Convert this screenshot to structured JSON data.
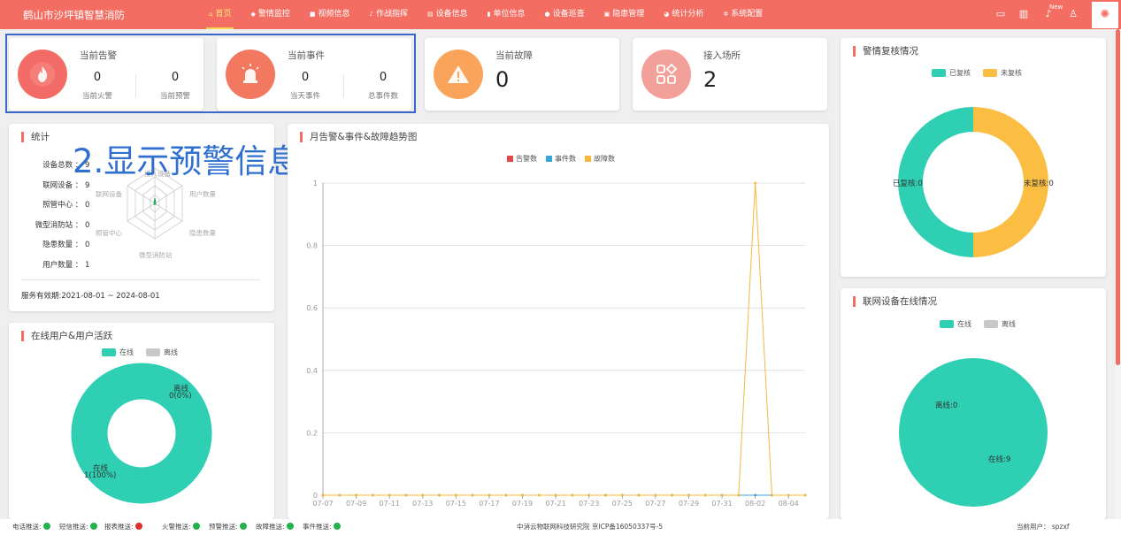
{
  "header": {
    "brand": "鹤山市沙坪镇智慧消防",
    "nav": [
      {
        "label": "首页",
        "icon": "home-icon",
        "glyph": "⌂",
        "active": true
      },
      {
        "label": "警情监控",
        "icon": "alarm-monitor-icon",
        "glyph": "◆",
        "active": false
      },
      {
        "label": "视频信息",
        "icon": "video-icon",
        "glyph": "■",
        "active": false
      },
      {
        "label": "作战指挥",
        "icon": "command-icon",
        "glyph": "♪",
        "active": false
      },
      {
        "label": "设备信息",
        "icon": "device-icon",
        "glyph": "▤",
        "active": false
      },
      {
        "label": "单位信息",
        "icon": "unit-icon",
        "glyph": "▮",
        "active": false
      },
      {
        "label": "设备巡查",
        "icon": "patrol-icon",
        "glyph": "●",
        "active": false
      },
      {
        "label": "隐患管理",
        "icon": "hazard-icon",
        "glyph": "▣",
        "active": false
      },
      {
        "label": "统计分析",
        "icon": "statistics-icon",
        "glyph": "◕",
        "active": false
      },
      {
        "label": "系统配置",
        "icon": "config-icon",
        "glyph": "✲",
        "active": false
      }
    ],
    "new_badge": "New"
  },
  "cards": {
    "alarm": {
      "title": "当前告警",
      "fire_value": "0",
      "fire_label": "当前火警",
      "warn_value": "0",
      "warn_label": "当前预警"
    },
    "event": {
      "title": "当前事件",
      "today_value": "0",
      "today_label": "当天事件",
      "total_value": "0",
      "total_label": "总事件数"
    },
    "fault": {
      "title": "当前故障",
      "value": "0"
    },
    "sites": {
      "title": "接入场所",
      "value": "2"
    }
  },
  "stats": {
    "title": "统计",
    "rows": [
      {
        "label": "设备总数",
        "value": "9"
      },
      {
        "label": "联网设备",
        "value": "9"
      },
      {
        "label": "照管中心",
        "value": "0"
      },
      {
        "label": "微型消防站",
        "value": "0"
      },
      {
        "label": "隐患数量",
        "value": "0"
      },
      {
        "label": "用户数量",
        "value": "1"
      }
    ],
    "radar_labels": [
      "接入设备",
      "用户数量",
      "隐患数量",
      "微型消防站",
      "照管中心",
      "联网设备"
    ],
    "service": "服务有效期:2021-08-01 ~ 2024-08-01"
  },
  "annotation": "2.显示预警信息",
  "online_users": {
    "title": "在线用户&用户活跃",
    "legend": [
      "在线",
      "离线"
    ],
    "offline_label": "离线",
    "offline_value": "0(0%)",
    "online_label": "在线",
    "online_value": "1(100%)"
  },
  "trend": {
    "title": "月告警&事件&故障趋势图",
    "legend": [
      "告警数",
      "事件数",
      "故障数"
    ]
  },
  "review": {
    "title": "警情复核情况",
    "legend": [
      "已复核",
      "未复核"
    ],
    "reviewed_label": "已复核:0",
    "unreviewed_label": "未复核:0"
  },
  "device_online": {
    "title": "联网设备在线情况",
    "legend": [
      "在线",
      "离线"
    ],
    "offline_label": "离线:0",
    "online_label": "在线:9"
  },
  "footer": {
    "items": [
      {
        "label": "电话推送:",
        "status": "green"
      },
      {
        "label": "短信推送:",
        "status": "green"
      },
      {
        "label": "报表推送:",
        "status": "red"
      },
      {
        "label": "火警推送:",
        "status": "green"
      },
      {
        "label": "预警推送:",
        "status": "green"
      },
      {
        "label": "故障推送:",
        "status": "green"
      },
      {
        "label": "事件推送:",
        "status": "green"
      }
    ],
    "copyright": "中消云物联网科技研究院 京ICP备16050337号-5",
    "user": "当前用户： spzxf"
  },
  "colors": {
    "accent": "#f36d62",
    "teal": "#2ecfb3",
    "amber": "#fbbd42",
    "grey": "#c8c8c8",
    "alarm_red": "#e2474b",
    "event_blue": "#3aa7d6",
    "fault_yellow": "#f6b73c",
    "status_green": "#22b24c",
    "status_red": "#e0302b"
  },
  "chart_data": [
    {
      "type": "line",
      "title": "月告警&事件&故障趋势图",
      "x": [
        "07-07",
        "07-08",
        "07-09",
        "07-10",
        "07-11",
        "07-12",
        "07-13",
        "07-14",
        "07-15",
        "07-16",
        "07-17",
        "07-18",
        "07-19",
        "07-20",
        "07-21",
        "07-22",
        "07-23",
        "07-24",
        "07-25",
        "07-26",
        "07-27",
        "07-28",
        "07-29",
        "07-30",
        "07-31",
        "08-01",
        "08-02",
        "08-03",
        "08-04",
        "08-05"
      ],
      "x_tick_labels": [
        "07-07",
        "07-09",
        "07-11",
        "07-13",
        "07-15",
        "07-17",
        "07-19",
        "07-21",
        "07-23",
        "07-25",
        "07-27",
        "07-29",
        "07-31",
        "08-02",
        "08-04"
      ],
      "series": [
        {
          "name": "告警数",
          "values": [
            0,
            0,
            0,
            0,
            0,
            0,
            0,
            0,
            0,
            0,
            0,
            0,
            0,
            0,
            0,
            0,
            0,
            0,
            0,
            0,
            0,
            0,
            0,
            0,
            0,
            0,
            0,
            0,
            0,
            0
          ]
        },
        {
          "name": "事件数",
          "values": [
            0,
            0,
            0,
            0,
            0,
            0,
            0,
            0,
            0,
            0,
            0,
            0,
            0,
            0,
            0,
            0,
            0,
            0,
            0,
            0,
            0,
            0,
            0,
            0,
            0,
            0,
            0,
            0,
            0,
            0
          ]
        },
        {
          "name": "故障数",
          "values": [
            0,
            0,
            0,
            0,
            0,
            0,
            0,
            0,
            0,
            0,
            0,
            0,
            0,
            0,
            0,
            0,
            0,
            0,
            0,
            0,
            0,
            0,
            0,
            0,
            0,
            0,
            1,
            0,
            0,
            0
          ]
        }
      ],
      "ylim": [
        0,
        1
      ],
      "y_ticks": [
        "0",
        "0.2",
        "0.4",
        "0.6",
        "0.8",
        "1"
      ],
      "grid": true,
      "legend_position": "top"
    },
    {
      "type": "pie",
      "title": "在线用户&用户活跃",
      "categories": [
        "在线",
        "离线"
      ],
      "values": [
        1,
        0
      ],
      "donut": true
    },
    {
      "type": "pie",
      "title": "警情复核情况",
      "categories": [
        "已复核",
        "未复核"
      ],
      "values": [
        0,
        0
      ],
      "donut": true
    },
    {
      "type": "pie",
      "title": "联网设备在线情况",
      "categories": [
        "在线",
        "离线"
      ],
      "values": [
        9,
        0
      ]
    }
  ]
}
